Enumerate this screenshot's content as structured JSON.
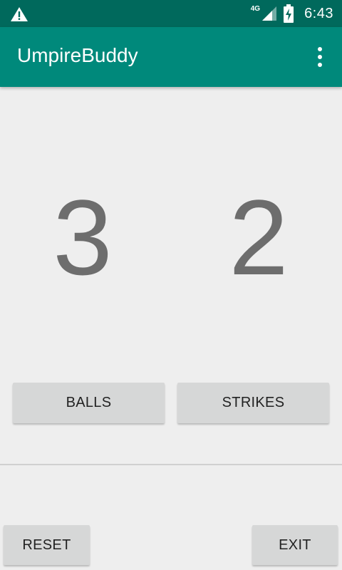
{
  "status_bar": {
    "network": "4G",
    "time": "6:43",
    "warning_icon": "warning-triangle-icon",
    "signal_icon": "cell-signal-icon",
    "battery_icon": "battery-charging-icon"
  },
  "app_bar": {
    "title": "UmpireBuddy",
    "menu_icon": "overflow-menu-icon",
    "color": "#00897b"
  },
  "counts": {
    "balls": "3",
    "strikes": "2"
  },
  "buttons": {
    "balls": "BALLS",
    "strikes": "STRIKES",
    "reset": "RESET",
    "exit": "EXIT"
  }
}
